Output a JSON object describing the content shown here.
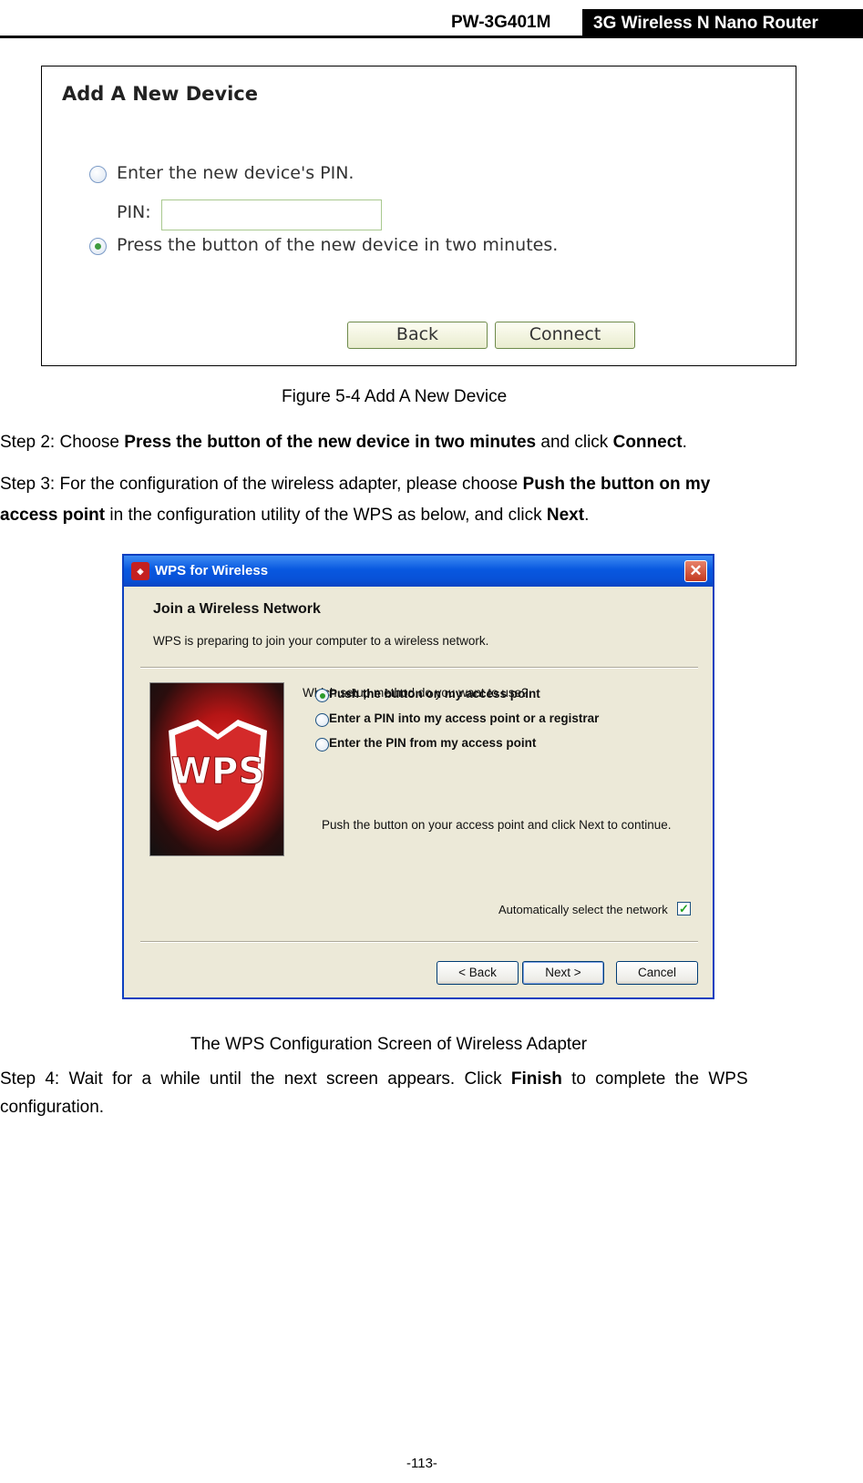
{
  "header": {
    "model": "PW-3G401M",
    "product": "3G Wireless N Nano Router"
  },
  "figure1": {
    "title": "Add A New Device",
    "option_pin": "Enter the new device's PIN.",
    "pin_label": "PIN:",
    "pin_value": "",
    "option_button": "Press the button of the new device in two minutes.",
    "back_button": "Back",
    "connect_button": "Connect",
    "caption": "Figure 5-4    Add A New Device"
  },
  "step2": {
    "prefix": "Step 2:    Choose ",
    "bold1": "Press the button of the new device in two minutes",
    "mid": " and click ",
    "bold2": "Connect",
    "end": "."
  },
  "step3": {
    "prefix": "Step 3:    For the configuration of the wireless adapter, please choose ",
    "bold1": "Push the button on my",
    "bold1b": "access point",
    "mid": " in the configuration utility of the WPS as below, and click ",
    "bold2": "Next",
    "end": "."
  },
  "figure2": {
    "window_title": "WPS for Wireless",
    "heading": "Join a Wireless Network",
    "subtitle": "WPS is preparing to join your computer to a wireless network.",
    "logo_text": "WPS",
    "question": "Which setup method do you want to use?",
    "options": [
      "Push the button on my access point",
      "Enter a PIN into my access point or a registrar",
      "Enter the PIN from my access point"
    ],
    "selected_option": 0,
    "note": "Push the button on your access point and click Next to continue.",
    "auto_select": "Automatically select the network",
    "auto_select_checked": true,
    "back_button": "< Back",
    "next_button": "Next >",
    "cancel_button": "Cancel",
    "caption": "The WPS Configuration Screen of Wireless Adapter"
  },
  "step4": {
    "prefix": "Step 4:   Wait for a while until the next screen appears. Click ",
    "bold1": "Finish",
    "end": " to complete the WPS",
    "line2": "configuration."
  },
  "footer": {
    "page_number": "-113-"
  }
}
